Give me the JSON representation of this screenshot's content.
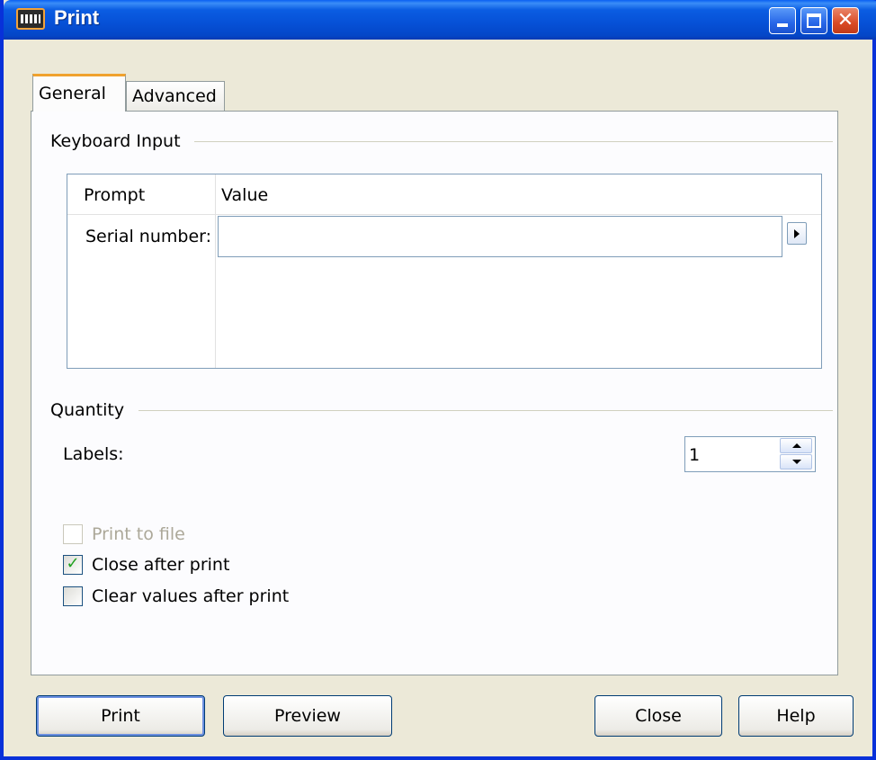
{
  "window": {
    "title": "Print"
  },
  "tabs": [
    {
      "label": "General",
      "selected": true
    },
    {
      "label": "Advanced",
      "selected": false
    }
  ],
  "keyboard_input": {
    "section_label": "Keyboard Input",
    "columns": [
      "Prompt",
      "Value"
    ],
    "rows": [
      {
        "prompt": "Serial number:",
        "value": ""
      }
    ]
  },
  "quantity": {
    "section_label": "Quantity",
    "labels_label": "Labels:",
    "labels_value": "1"
  },
  "options": [
    {
      "label": "Print to file",
      "checked": false,
      "enabled": false
    },
    {
      "label": "Close after print",
      "checked": true,
      "enabled": true
    },
    {
      "label": "Clear values after print",
      "checked": false,
      "enabled": true
    }
  ],
  "buttons": {
    "print": "Print",
    "preview": "Preview",
    "close": "Close",
    "help": "Help"
  },
  "icons": {
    "app": "keyboard-icon",
    "minimize": "minimize-icon",
    "maximize": "maximize-icon",
    "close": "close-icon",
    "arrow": "arrow-right-icon",
    "spin_up": "spin-up-icon",
    "spin_down": "spin-down-icon",
    "check": "check-icon"
  },
  "colors": {
    "titlebar": "#0650d6",
    "tab_accent": "#f0a22e",
    "checkmark": "#21a121",
    "disabled_text": "#aca899"
  }
}
